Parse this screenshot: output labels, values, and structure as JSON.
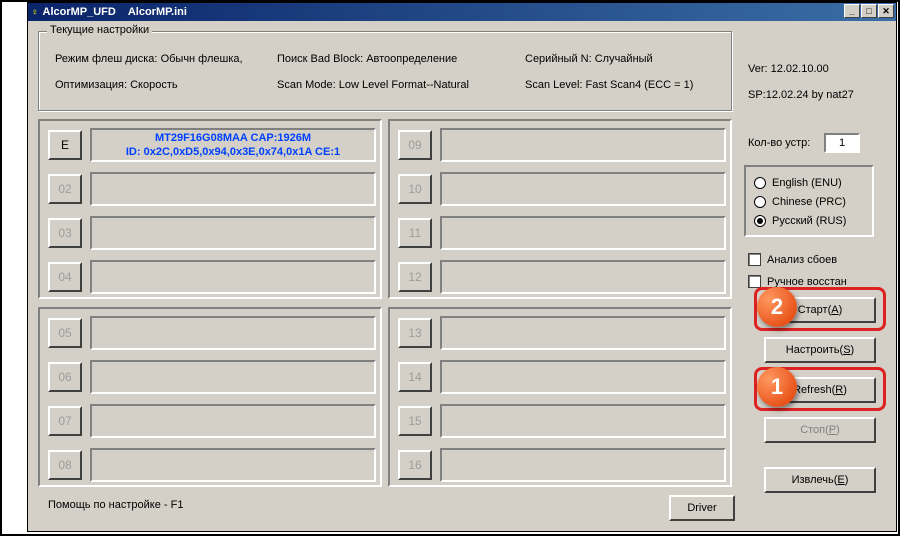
{
  "titlebar": {
    "app": "AlcorMP_UFD",
    "file": "AlcorMP.ini"
  },
  "settings": {
    "legend": "Текущие настройки",
    "flash_mode_label": "Режим флеш диска:",
    "flash_mode_value": "Обычн флешка,",
    "badblock_label": "Поиск Bad Block:",
    "badblock_value": "Автоопределение",
    "serial_label": "Серийный N:",
    "serial_value": "Случайный",
    "opt_label": "Оптимизация:",
    "opt_value": "Скорость",
    "scanmode_label": "Scan Mode:",
    "scanmode_value": "Low Level Format--Natural",
    "scanlevel_label": "Scan Level:",
    "scanlevel_value": "Fast Scan4 (ECC = 1)"
  },
  "slots": {
    "s01": {
      "num": "E",
      "line1": "MT29F16G08MAA CAP:1926M",
      "line2": "ID: 0x2C,0xD5,0x94,0x3E,0x74,0x1A  CE:1",
      "active": true
    },
    "s02": {
      "num": "02"
    },
    "s03": {
      "num": "03"
    },
    "s04": {
      "num": "04"
    },
    "s05": {
      "num": "05"
    },
    "s06": {
      "num": "06"
    },
    "s07": {
      "num": "07"
    },
    "s08": {
      "num": "08"
    },
    "s09": {
      "num": "09"
    },
    "s10": {
      "num": "10"
    },
    "s11": {
      "num": "11"
    },
    "s12": {
      "num": "12"
    },
    "s13": {
      "num": "13"
    },
    "s14": {
      "num": "14"
    },
    "s15": {
      "num": "15"
    },
    "s16": {
      "num": "16"
    }
  },
  "right": {
    "ver": "Ver: 12.02.10.00",
    "sp": "SP:12.02.24 by nat27",
    "count_label": "Кол-во устр:",
    "count_value": "1",
    "lang_en": "English (ENU)",
    "lang_cn": "Chinese (PRC)",
    "lang_ru": "Русский (RUS)",
    "chk_crash": "Анализ сбоев",
    "chk_manual": "Ручное восстан",
    "btn_start_pre": "Старт(",
    "btn_start_u": "A",
    "btn_start_post": ")",
    "btn_setup_pre": "Настроить(",
    "btn_setup_u": "S",
    "btn_setup_post": ")",
    "btn_refresh_pre": "Refresh(",
    "btn_refresh_u": "R",
    "btn_refresh_post": ")",
    "btn_stop_pre": "Стоп(",
    "btn_stop_u": "P",
    "btn_stop_post": ")",
    "btn_eject_pre": "Извлечь(",
    "btn_eject_u": "E",
    "btn_eject_post": ")"
  },
  "bottom": {
    "help": "Помощь по настройке - F1",
    "driver": "Driver"
  },
  "callouts": {
    "one": "1",
    "two": "2"
  }
}
